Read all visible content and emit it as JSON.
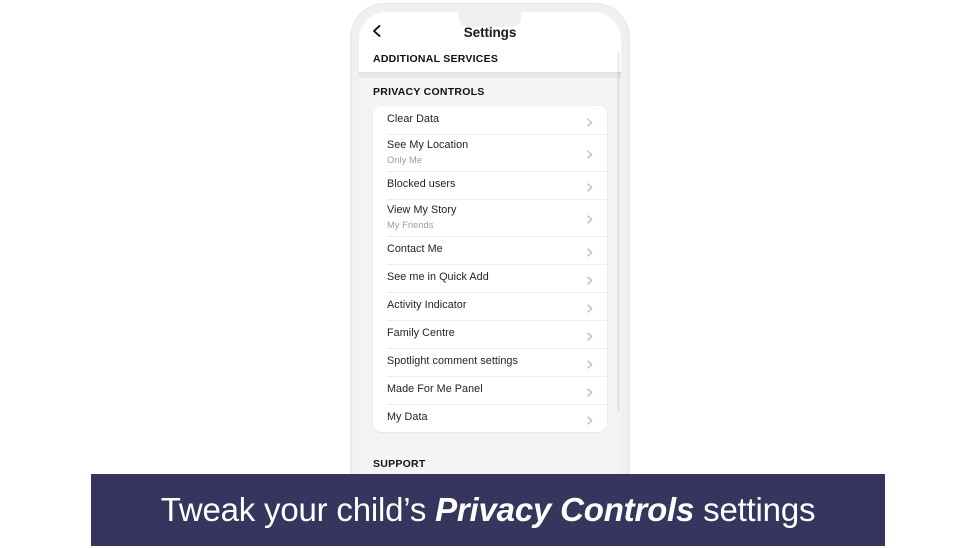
{
  "device": {
    "frame_color": "#f0f0f0",
    "screen_background": "#ffffff"
  },
  "nav": {
    "back_icon": "chevron-left-icon",
    "title": "Settings"
  },
  "sections": [
    {
      "id": "additional-services",
      "label": "ADDITIONAL SERVICES"
    },
    {
      "id": "privacy-controls",
      "label": "PRIVACY CONTROLS"
    },
    {
      "id": "support",
      "label": "SUPPORT"
    }
  ],
  "privacy_controls": {
    "header": "PRIVACY CONTROLS",
    "rows": [
      {
        "title": "Clear Data",
        "subtitle": "",
        "chevron": "chevron-right-icon"
      },
      {
        "title": "See My Location",
        "subtitle": "Only Me",
        "chevron": "chevron-right-icon"
      },
      {
        "title": "Blocked users",
        "subtitle": "",
        "chevron": "chevron-right-icon"
      },
      {
        "title": "View My Story",
        "subtitle": "My Friends",
        "chevron": "chevron-right-icon"
      },
      {
        "title": "Contact Me",
        "subtitle": "",
        "chevron": "chevron-right-icon"
      },
      {
        "title": "See me in Quick Add",
        "subtitle": "",
        "chevron": "chevron-right-icon"
      },
      {
        "title": "Activity Indicator",
        "subtitle": "",
        "chevron": "chevron-right-icon"
      },
      {
        "title": "Family Centre",
        "subtitle": "",
        "chevron": "chevron-right-icon"
      },
      {
        "title": "Spotlight comment settings",
        "subtitle": "",
        "chevron": "chevron-right-icon"
      },
      {
        "title": "Made For Me Panel",
        "subtitle": "",
        "chevron": "chevron-right-icon"
      },
      {
        "title": "My Data",
        "subtitle": "",
        "chevron": "chevron-right-icon"
      }
    ]
  },
  "caption": {
    "prefix": "Tweak your child’s ",
    "emphasis": "Privacy Controls",
    "suffix": " settings",
    "background_color": "#35355e",
    "text_color": "#ffffff"
  },
  "colors": {
    "section_bg": "#f4f4f6",
    "card_bg": "#ffffff",
    "divider": "#eeeeef",
    "title_text": "#1f1f21",
    "subtitle_text": "#9c9ca2",
    "chevron": "#c3c3c8"
  }
}
